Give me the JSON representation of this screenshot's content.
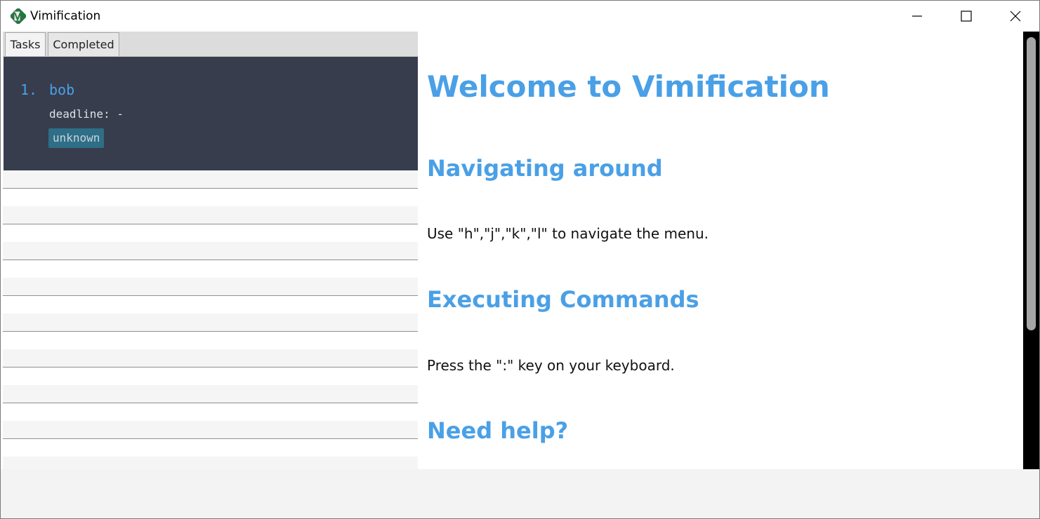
{
  "window": {
    "title": "Vimification",
    "icon": "vim-app-icon",
    "controls": [
      "minimize-icon",
      "maximize-icon",
      "close-icon"
    ]
  },
  "tabs": [
    {
      "label": "Tasks",
      "selected": true
    },
    {
      "label": "Completed",
      "selected": false
    }
  ],
  "tasks": [
    {
      "index": "1.",
      "name": "bob",
      "deadline": "deadline: -",
      "tag": "unknown"
    }
  ],
  "help": {
    "title": "Welcome to Vimification",
    "sections": [
      {
        "heading": "Navigating around",
        "text": "Use \"h\",\"j\",\"k\",\"l\" to navigate the menu."
      },
      {
        "heading": "Executing Commands",
        "text": "Press the \":\" key on your keyboard."
      },
      {
        "heading": "Need help?",
        "text": ""
      }
    ]
  },
  "colors": {
    "accent": "#4aa0e6",
    "card_bg": "#373d4d",
    "tag_bg": "#2e6e87"
  }
}
